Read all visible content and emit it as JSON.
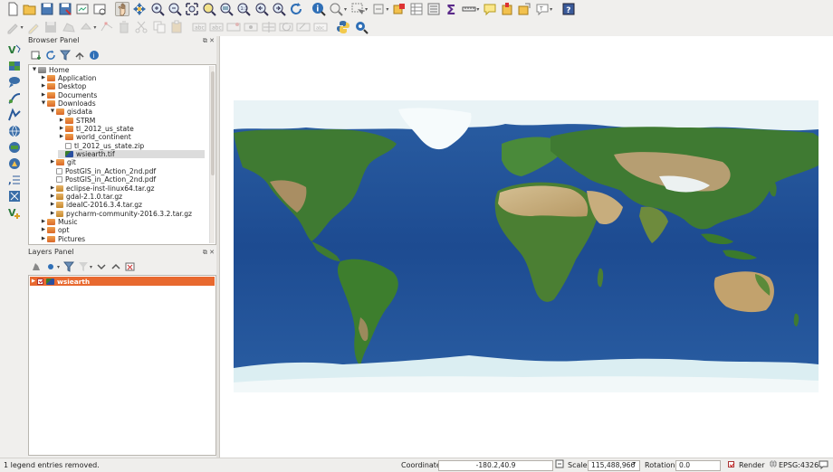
{
  "browser_panel": {
    "title": "Browser Panel",
    "items": [
      {
        "label": "Home",
        "icon": "home-folder-icon",
        "expanded": true,
        "depth": 0
      },
      {
        "label": "Application",
        "icon": "folder-icon",
        "expanded": false,
        "depth": 1
      },
      {
        "label": "Desktop",
        "icon": "folder-icon",
        "expanded": false,
        "depth": 1
      },
      {
        "label": "Documents",
        "icon": "folder-icon",
        "expanded": false,
        "depth": 1
      },
      {
        "label": "Downloads",
        "icon": "folder-icon",
        "expanded": true,
        "depth": 1
      },
      {
        "label": "gisdata",
        "icon": "folder-icon",
        "expanded": true,
        "depth": 2
      },
      {
        "label": "STRM",
        "icon": "folder-icon",
        "expanded": false,
        "depth": 3
      },
      {
        "label": "tl_2012_us_state",
        "icon": "folder-icon",
        "expanded": false,
        "depth": 3
      },
      {
        "label": "world_continent",
        "icon": "folder-icon",
        "expanded": false,
        "depth": 3
      },
      {
        "label": "tl_2012_us_state.zip",
        "icon": "zip-file-icon",
        "depth": 3
      },
      {
        "label": "wsiearth.tif",
        "icon": "raster-file-icon",
        "depth": 3,
        "selected": true
      },
      {
        "label": "git",
        "icon": "folder-icon",
        "expanded": false,
        "depth": 2
      },
      {
        "label": "PostGIS_in_Action_2nd.pdf",
        "icon": "pdf-file-icon",
        "depth": 2
      },
      {
        "label": "PostGIS_in_Action_2nd.pdf",
        "icon": "pdf-file-icon",
        "depth": 2
      },
      {
        "label": "eclipse-inst-linux64.tar.gz",
        "icon": "archive-icon",
        "expanded": false,
        "depth": 2
      },
      {
        "label": "gdal-2.1.0.tar.gz",
        "icon": "archive-icon",
        "expanded": false,
        "depth": 2
      },
      {
        "label": "ideaIC-2016.3.4.tar.gz",
        "icon": "archive-icon",
        "expanded": false,
        "depth": 2
      },
      {
        "label": "pycharm-community-2016.3.2.tar.gz",
        "icon": "archive-icon",
        "expanded": false,
        "depth": 2
      },
      {
        "label": "Music",
        "icon": "folder-icon",
        "expanded": false,
        "depth": 1
      },
      {
        "label": "opt",
        "icon": "folder-icon",
        "expanded": false,
        "depth": 1
      },
      {
        "label": "Pictures",
        "icon": "folder-icon",
        "expanded": false,
        "depth": 1
      }
    ]
  },
  "layers_panel": {
    "title": "Layers Panel",
    "layers": [
      {
        "label": "wsiearth",
        "visible": true,
        "selected": true,
        "icon": "raster-layer-icon"
      }
    ]
  },
  "status_bar": {
    "message": "1 legend entries removed.",
    "coordinate_label": "Coordinate",
    "coordinate_value": "-180.2,40.9",
    "scale_label": "Scale",
    "scale_value": "115,488,966",
    "rotation_label": "Rotation",
    "rotation_value": "0.0",
    "render_label": "Render",
    "render_checked": true,
    "crs_label": "EPSG:4326"
  },
  "colors": {
    "selection": "#e8692f",
    "ocean": "#1f4f96",
    "land": "#3f7a32",
    "desert": "#c9b184",
    "ice": "#e6f2f5"
  }
}
